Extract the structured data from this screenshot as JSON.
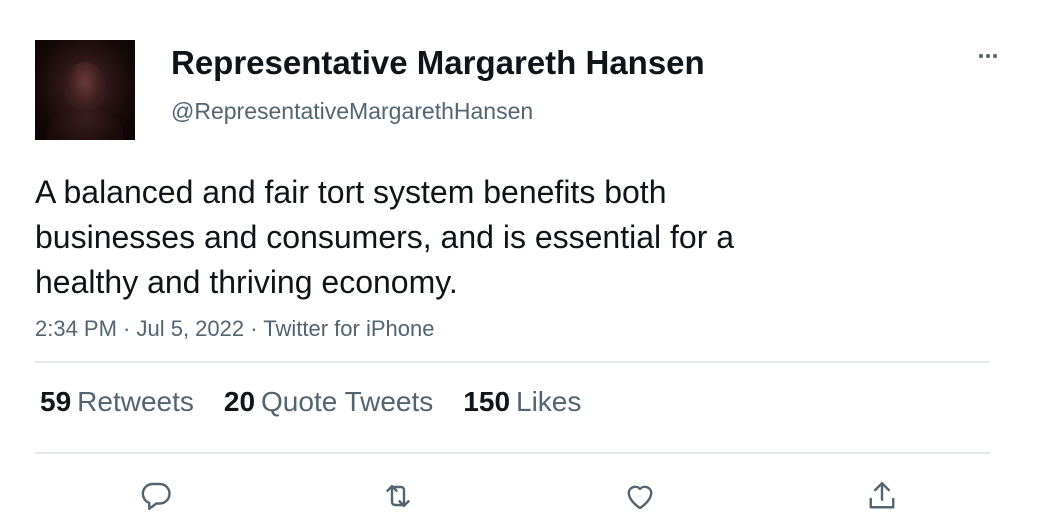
{
  "author": {
    "display_name": "Representative Margareth Hansen",
    "handle": "@RepresentativeMargarethHansen"
  },
  "tweet": {
    "text": "A balanced and fair tort system benefits both businesses and consumers, and is essential for a healthy and thriving economy.",
    "meta": "2:34 PM · Jul 5, 2022 · Twitter for iPhone"
  },
  "stats": {
    "retweets": {
      "count": "59",
      "label": "Retweets"
    },
    "quote_tweets": {
      "count": "20",
      "label": "Quote Tweets"
    },
    "likes": {
      "count": "150",
      "label": "Likes"
    }
  },
  "icons": {
    "more": "more-horizontal-icon",
    "reply": "reply-icon",
    "retweet": "retweet-icon",
    "like": "heart-icon",
    "share": "share-icon"
  },
  "colors": {
    "text_primary": "#0f1419",
    "text_secondary": "#536471",
    "divider": "#e4e7ea"
  }
}
